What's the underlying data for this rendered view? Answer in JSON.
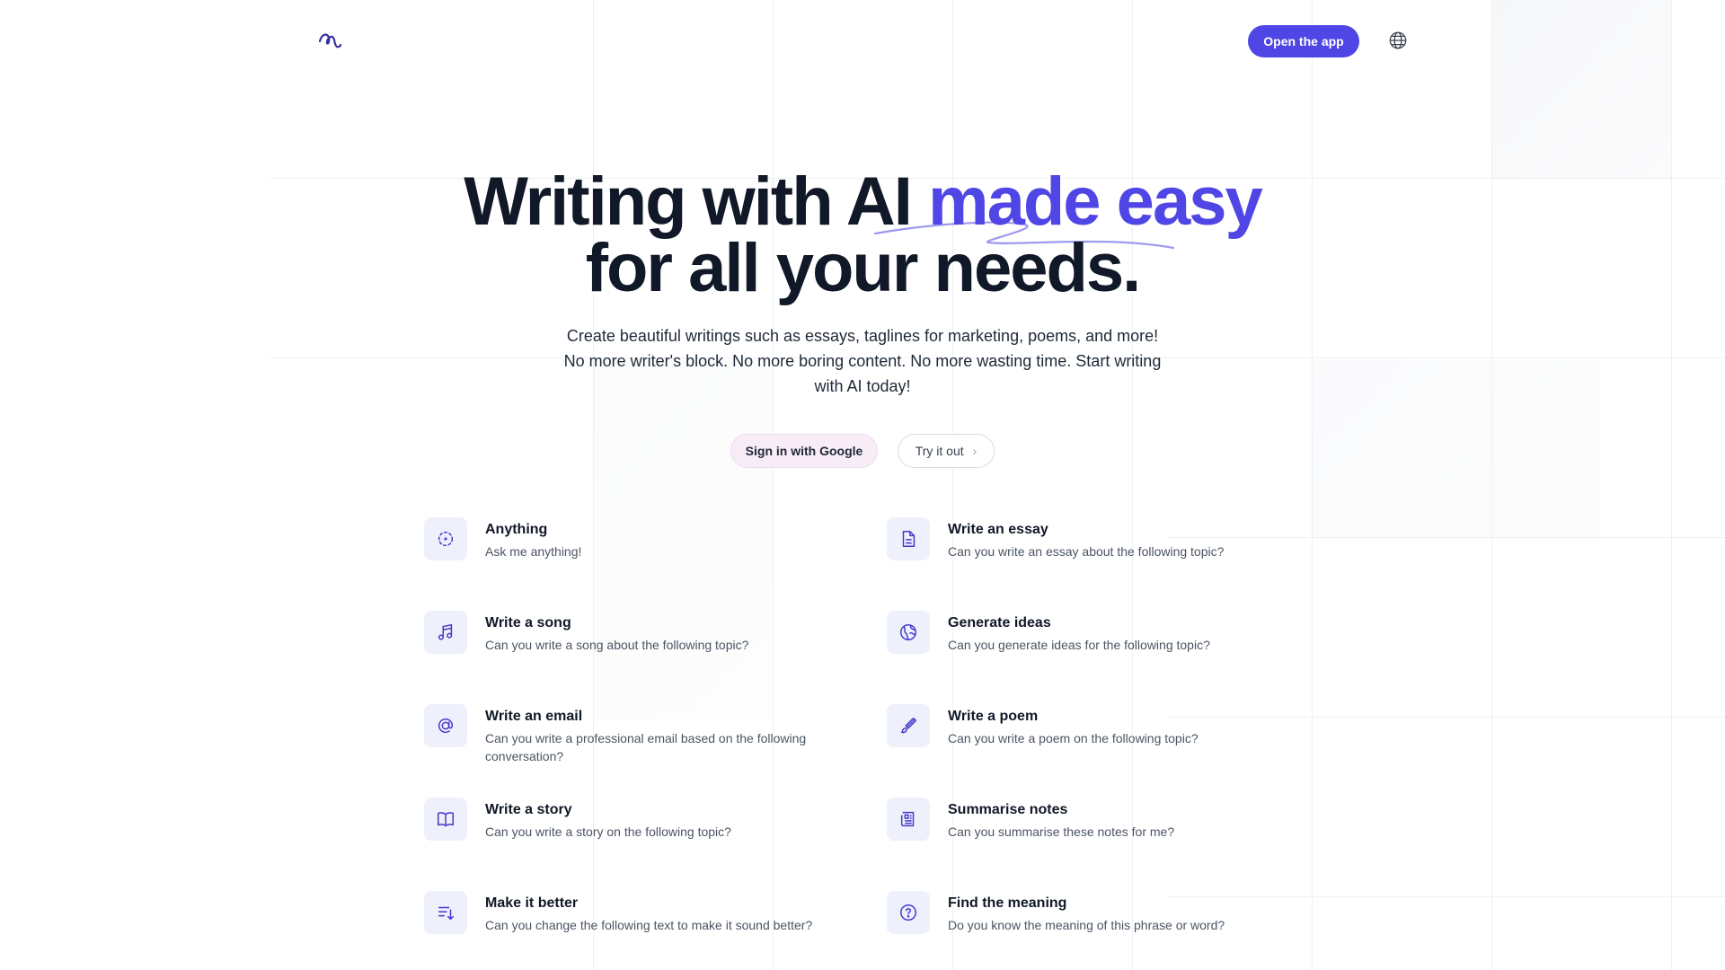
{
  "header": {
    "open_app_label": "Open the app"
  },
  "hero": {
    "title_part1": "Writing with AI ",
    "title_accent": "made easy",
    "title_part2": " for all your needs.",
    "subtitle_line1": "Create beautiful writings such as essays, taglines for marketing, poems, and more!",
    "subtitle_line2": "No more writer's block. No more boring content. No more wasting time. Start writing",
    "subtitle_line3": "with AI today!",
    "accent_color": "#4f46e5"
  },
  "cta": {
    "google_label": "Sign in with Google",
    "try_label": "Try it out"
  },
  "prompts": [
    {
      "title": "Anything",
      "desc": "Ask me anything!",
      "icon": "sparkle-circle-icon"
    },
    {
      "title": "Write an essay",
      "desc": "Can you write an essay about the following topic?",
      "icon": "document-icon"
    },
    {
      "title": "Write a song",
      "desc": "Can you write a song about the following topic?",
      "icon": "music-note-icon"
    },
    {
      "title": "Generate ideas",
      "desc": "Can you generate ideas for the following topic?",
      "icon": "globe-ideas-icon"
    },
    {
      "title": "Write an email",
      "desc": "Can you write a professional email based on the following conversation?",
      "icon": "at-sign-icon"
    },
    {
      "title": "Write a poem",
      "desc": "Can you write a poem on the following topic?",
      "icon": "brush-icon"
    },
    {
      "title": "Write a story",
      "desc": "Can you write a story on the following topic?",
      "icon": "book-open-icon"
    },
    {
      "title": "Summarise notes",
      "desc": "Can you summarise these notes for me?",
      "icon": "newspaper-icon"
    },
    {
      "title": "Make it better",
      "desc": "Can you change the following text to make it sound better?",
      "icon": "list-sort-icon"
    },
    {
      "title": "Find the meaning",
      "desc": "Do you know the meaning of this phrase or word?",
      "icon": "question-circle-icon"
    }
  ]
}
